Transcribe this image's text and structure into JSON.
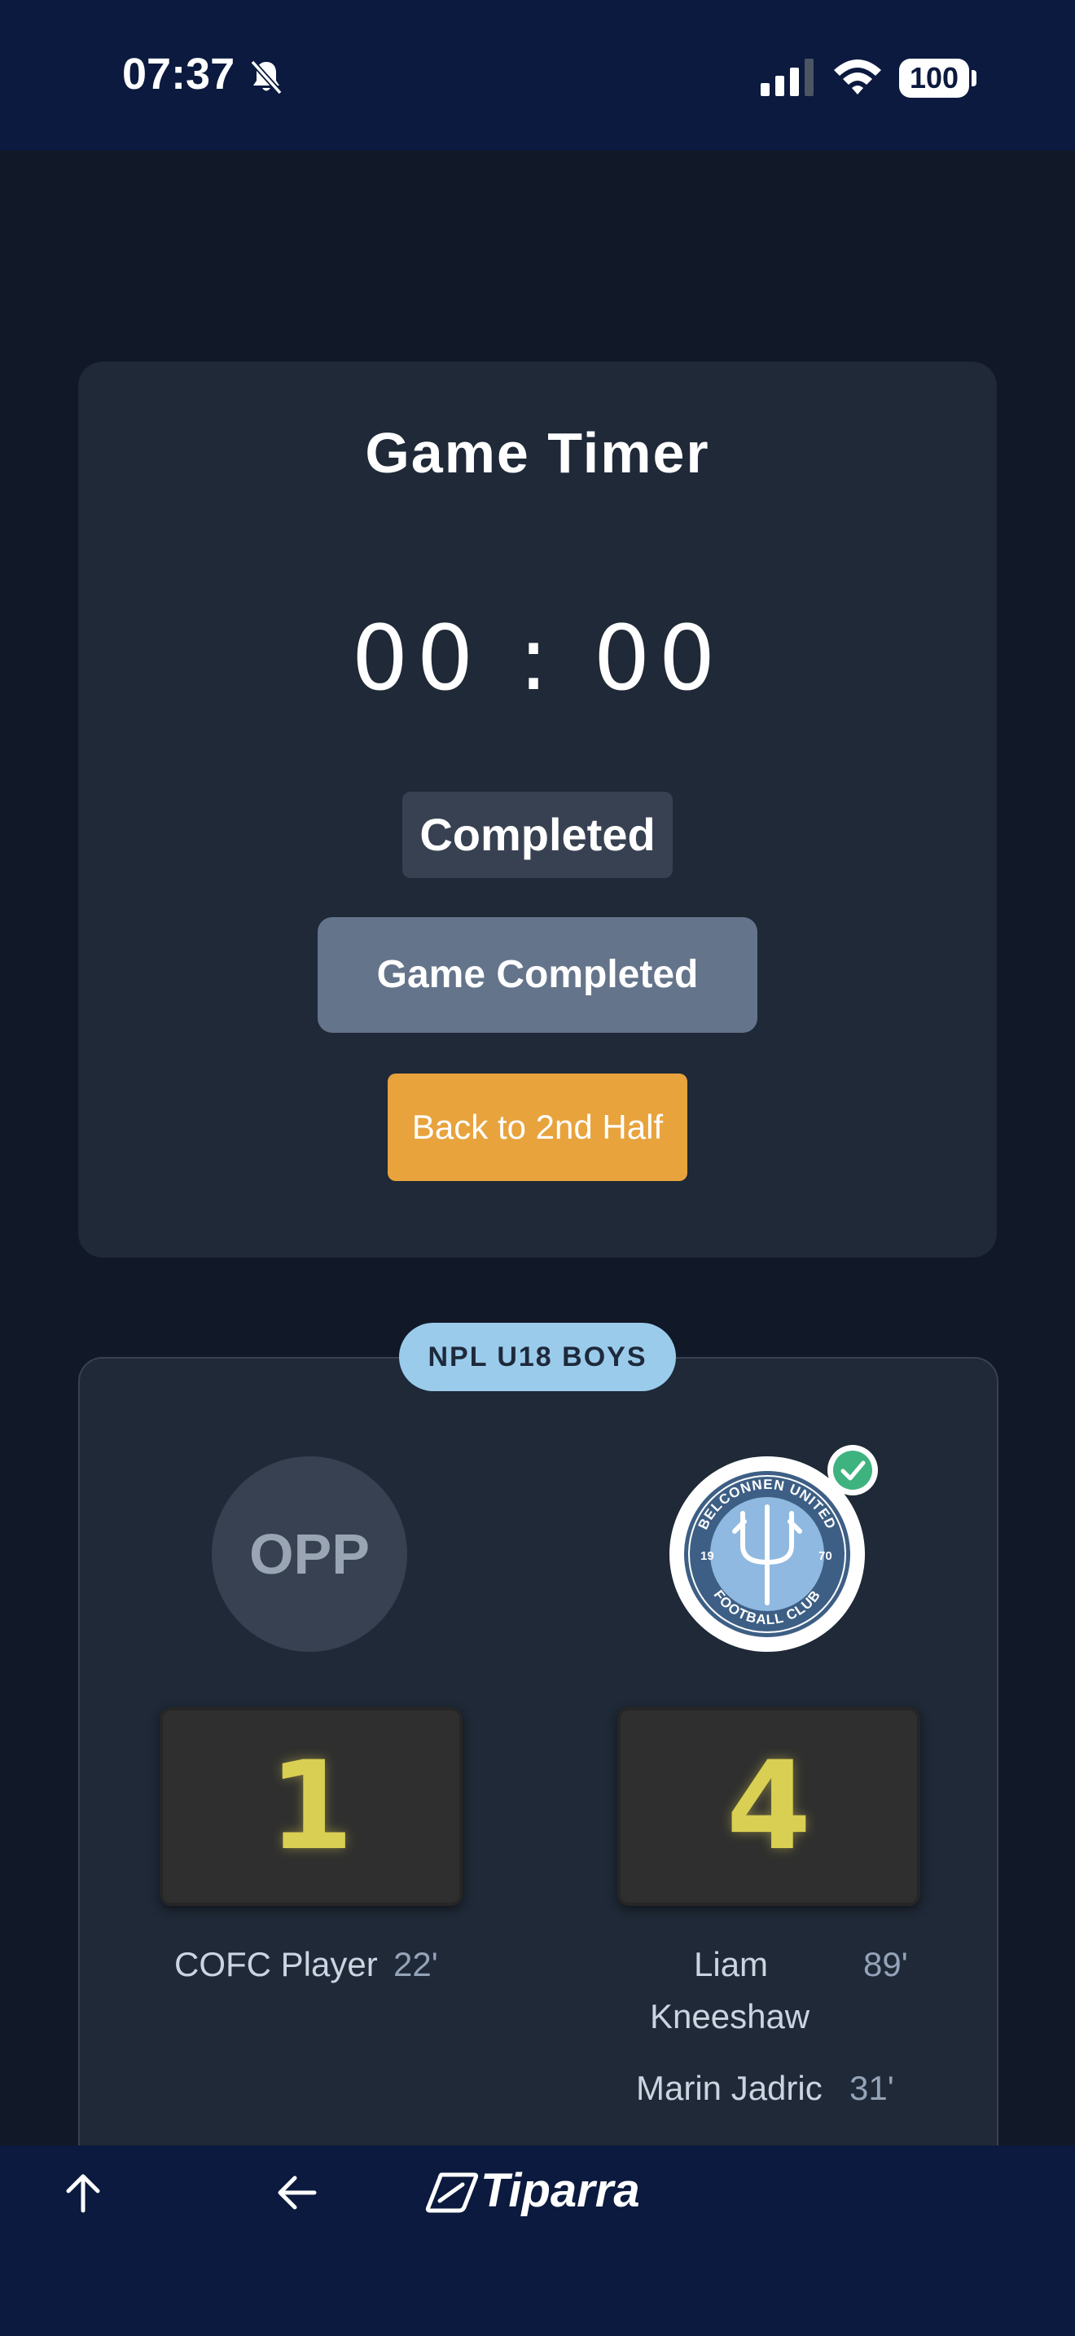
{
  "status_bar": {
    "time": "07:37",
    "battery": "100"
  },
  "timer": {
    "title": "Game Timer",
    "display": "00 : 00",
    "status": "Completed",
    "primary_button": "Game Completed",
    "secondary_button": "Back to 2nd Half"
  },
  "match": {
    "league": "NPL U18 BOYS",
    "home": {
      "label": "OPP",
      "score": "1"
    },
    "away": {
      "logo_top_text": "BELCONNEN UNITED",
      "logo_bottom_text": "FOOTBALL CLUB",
      "logo_year_left": "19",
      "logo_year_right": "70",
      "score": "4"
    },
    "home_scorers": [
      {
        "name": "COFC Player",
        "minute": "22'"
      }
    ],
    "away_scorers": [
      {
        "name_line1": "Liam",
        "name_line2": "Kneeshaw",
        "minute": "89'"
      },
      {
        "name": "Marin Jadric",
        "minute": "31'"
      }
    ]
  },
  "bottom_bar": {
    "brand": "Tiparra"
  },
  "colors": {
    "accent_orange": "#e8a33d",
    "score_yellow": "#d9cf52",
    "navy": "#0b1a3e"
  }
}
